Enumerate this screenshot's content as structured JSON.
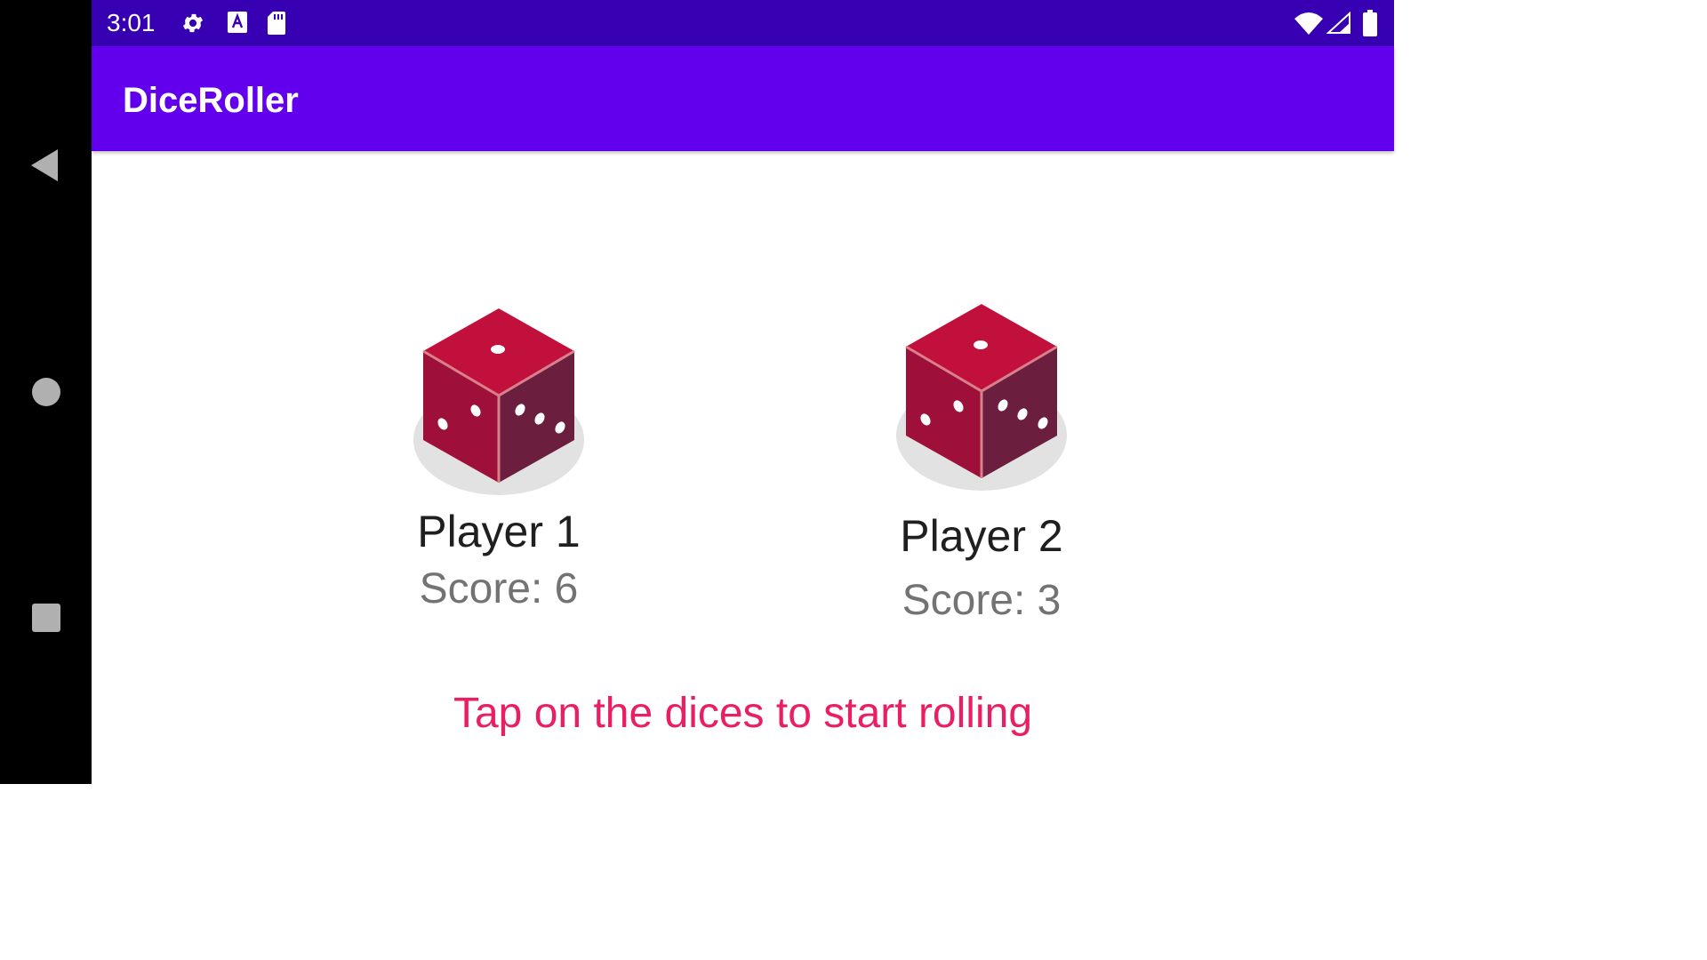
{
  "status_bar": {
    "time": "3:01",
    "icons": [
      "settings-icon",
      "keyboard-a-icon",
      "sd-card-icon",
      "wifi-icon",
      "cell-signal-icon",
      "battery-icon"
    ]
  },
  "app_bar": {
    "title": "DiceRoller"
  },
  "players": [
    {
      "name": "Player 1",
      "score": "Score: 6"
    },
    {
      "name": "Player 2",
      "score": "Score: 3"
    }
  ],
  "hint": "Tap on the dices to start rolling",
  "navigation": {
    "buttons": [
      "back",
      "home",
      "recents"
    ]
  },
  "colors": {
    "status_bar": "#3700b3",
    "app_bar": "#6200ee",
    "hint_text": "#e91e63",
    "dice_top": "#c0103b",
    "dice_left": "#9e0f3a",
    "dice_right": "#6b1e3e"
  }
}
